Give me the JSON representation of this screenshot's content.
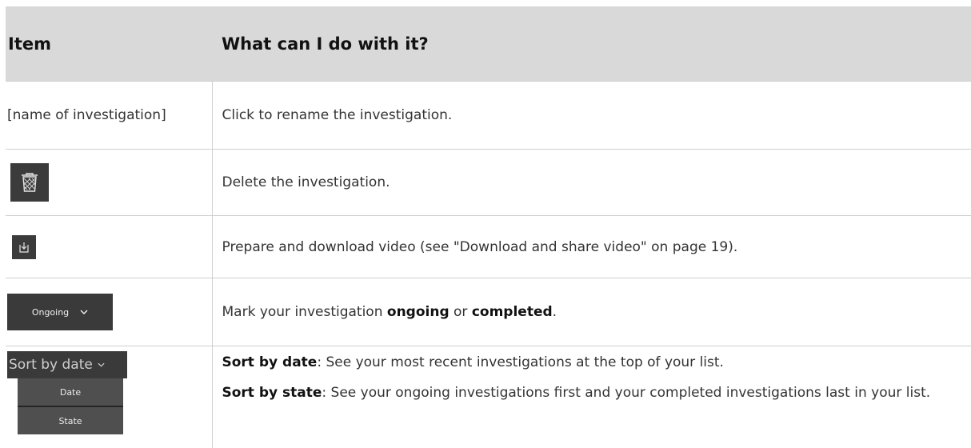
{
  "table": {
    "headers": [
      "Item",
      "What can I do with it?"
    ],
    "rows": {
      "name": {
        "item": "[name of investigation]",
        "desc": "Click to rename the investigation."
      },
      "delete": {
        "icon": "trash-icon",
        "desc": "Delete the investigation."
      },
      "download": {
        "icon": "download-icon",
        "desc": "Prepare and download video (see \"Download and share video\" on page 19)."
      },
      "state": {
        "dropdown_label": "Ongoing",
        "desc_prefix": "Mark your investigation ",
        "bold1": "ongoing",
        "desc_mid": " or ",
        "bold2": "completed",
        "desc_suffix": "."
      },
      "sort": {
        "dropdown_label": "Sort by date",
        "options": [
          "Date",
          "State"
        ],
        "date_bold": "Sort by date",
        "date_text": ": See your most recent investigations at the top of your list.",
        "state_bold": "Sort by state",
        "state_text": ": See your ongoing investigations first and your completed investigations last in your list."
      }
    }
  },
  "colors": {
    "header_bg": "#d9d9d9",
    "control_bg": "#3a3a3a"
  }
}
